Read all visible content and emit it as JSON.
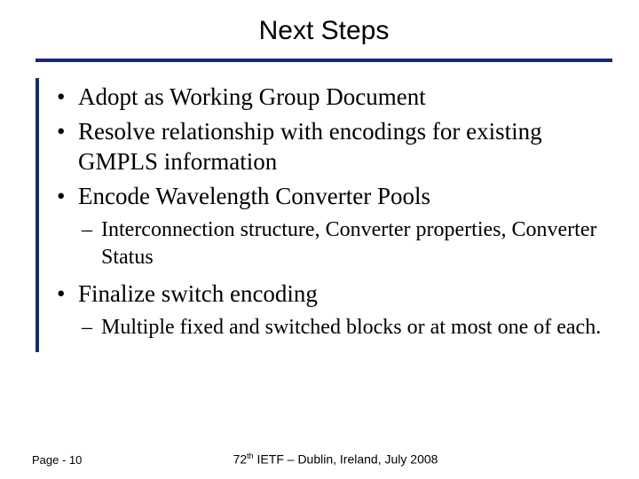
{
  "title": "Next Steps",
  "bullets": {
    "b0": "Adopt as Working Group Document",
    "b1": "Resolve relationship with encodings for existing GMPLS information",
    "b2": "Encode Wavelength Converter Pools",
    "b2_sub0": "Interconnection structure, Converter properties, Converter Status",
    "b3": "Finalize switch encoding",
    "b3_sub0": "Multiple fixed and switched blocks or at most one of each."
  },
  "footer": {
    "page_label": "Page - 10",
    "venue_prefix": "72",
    "venue_ordinal": "th",
    "venue_rest": " IETF – Dublin, Ireland, July 2008"
  }
}
